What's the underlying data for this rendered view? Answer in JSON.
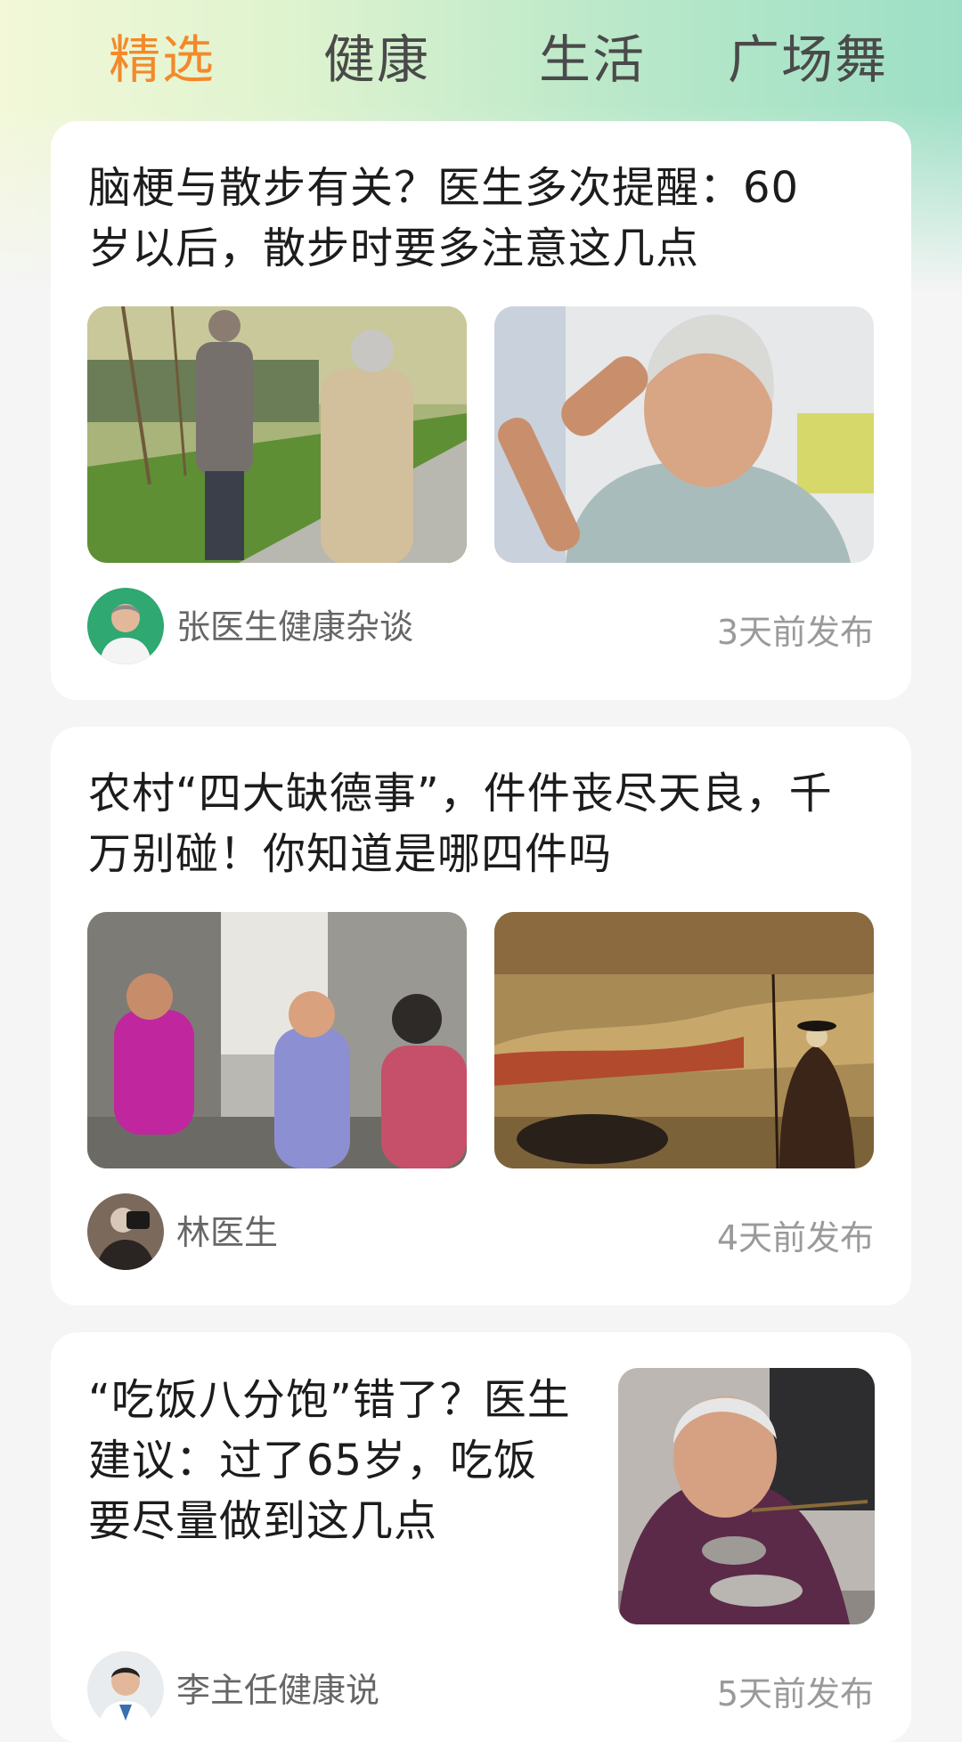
{
  "tabs": [
    {
      "label": "精选",
      "active": true
    },
    {
      "label": "健康",
      "active": false
    },
    {
      "label": "生活",
      "active": false
    },
    {
      "label": "广场舞",
      "active": false
    }
  ],
  "colors": {
    "accent": "#f4892a",
    "tab_text": "#4a4a4a",
    "card_bg": "#ffffff",
    "page_bg": "#f5f5f5"
  },
  "articles": [
    {
      "title_lines": [
        "脑梗与散步有关？医生多次提醒：60",
        "岁以后，散步时要多注意这几点"
      ],
      "images": [
        "elderly-couple-walking-park-photo",
        "elderly-woman-headache-photo"
      ],
      "author": "张医生健康杂谈",
      "time": "3天前发布"
    },
    {
      "title_lines": [
        "农村“四大缺德事”，件件丧尽天良，千",
        "万别碰！你知道是哪四件吗"
      ],
      "images": [
        "village-women-chatting-photo",
        "ancient-painting-herdsman-ox-photo"
      ],
      "author": "林医生",
      "time": "4天前发布"
    },
    {
      "title_lines": [
        "“吃饭八分饱”错了？医生",
        "建议：过了65岁，吃饭",
        "要尽量做到这几点"
      ],
      "images": [
        "elderly-woman-eating-photo"
      ],
      "author": "李主任健康说",
      "time": "5天前发布"
    }
  ]
}
